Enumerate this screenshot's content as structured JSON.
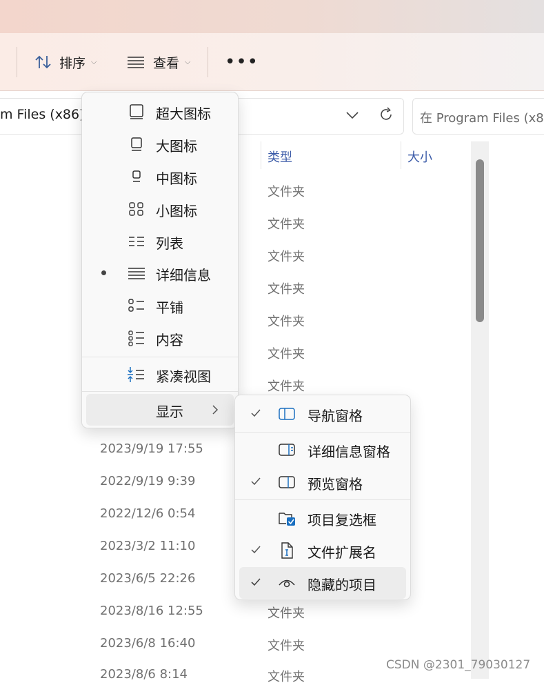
{
  "toolbar": {
    "sort_label": "排序",
    "view_label": "查看",
    "more_label": "•••"
  },
  "address": {
    "path_text": "m Files (x86)",
    "search_placeholder": "在 Program Files (x86"
  },
  "columns": {
    "type": "类型",
    "size": "大小"
  },
  "rows_top": [
    {
      "type": "文件夹"
    },
    {
      "type": "文件夹"
    },
    {
      "type": "文件夹"
    },
    {
      "type": "文件夹"
    },
    {
      "type": "文件夹"
    },
    {
      "type": "文件夹"
    },
    {
      "type": "文件夹"
    }
  ],
  "rows_bottom": [
    {
      "date": "2023/9/19 17:55",
      "type": ""
    },
    {
      "date": "2022/9/19 9:39",
      "type": ""
    },
    {
      "date": "2022/12/6 0:54",
      "type": ""
    },
    {
      "date": "2023/3/2 11:10",
      "type": ""
    },
    {
      "date": "2023/6/5 22:26",
      "type": ""
    },
    {
      "date": "2023/8/16 12:55",
      "type": "文件夹"
    },
    {
      "date": "2023/6/8 16:40",
      "type": "文件夹"
    },
    {
      "date": "2023/8/6 8:14",
      "type": "文件夹"
    }
  ],
  "view_menu": {
    "items": [
      {
        "label": "超大图标",
        "icon": "extra-large-icons-icon"
      },
      {
        "label": "大图标",
        "icon": "large-icons-icon"
      },
      {
        "label": "中图标",
        "icon": "medium-icons-icon"
      },
      {
        "label": "小图标",
        "icon": "small-icons-icon"
      },
      {
        "label": "列表",
        "icon": "list-icon"
      },
      {
        "label": "详细信息",
        "icon": "details-icon",
        "selected": true
      },
      {
        "label": "平铺",
        "icon": "tiles-icon"
      },
      {
        "label": "内容",
        "icon": "content-icon"
      }
    ],
    "compact_label": "紧凑视图",
    "show_label": "显示"
  },
  "show_menu": {
    "items": [
      {
        "label": "导航窗格",
        "checked": true
      },
      {
        "label": "详细信息窗格",
        "checked": false
      },
      {
        "label": "预览窗格",
        "checked": true
      },
      {
        "label": "项目复选框",
        "checked": false
      },
      {
        "label": "文件扩展名",
        "checked": true
      },
      {
        "label": "隐藏的项目",
        "checked": true
      }
    ]
  },
  "watermark": "CSDN @2301_79030127",
  "colors": {
    "accent": "#1a6fc0",
    "header_text": "#3b5ba8",
    "secondary_text": "#707070"
  }
}
